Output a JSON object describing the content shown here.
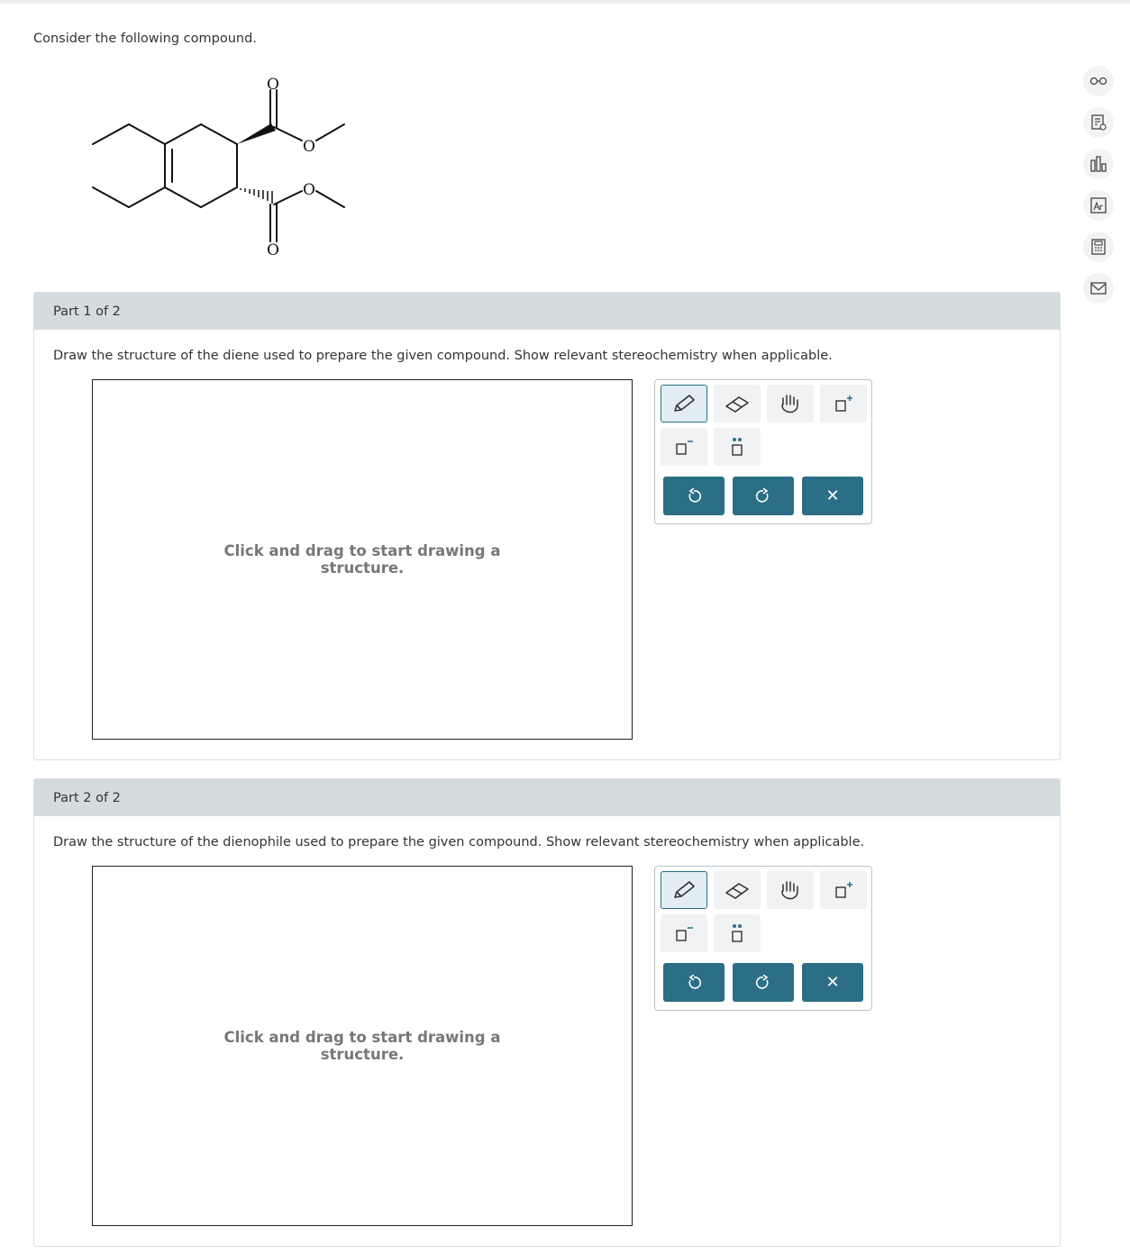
{
  "intro": "Consider the following compound.",
  "molecule": {
    "atom_labels": [
      "O",
      "O",
      "O",
      "O"
    ]
  },
  "parts": [
    {
      "header": "Part 1 of 2",
      "question": "Draw the structure of the diene used to prepare the given compound. Show relevant stereochemistry when applicable.",
      "canvas_hint_line1": "Click and drag to start drawing a",
      "canvas_hint_line2": "structure."
    },
    {
      "header": "Part 2 of 2",
      "question": "Draw the structure of the dienophile used to prepare the given compound. Show relevant stereochemistry when applicable.",
      "canvas_hint_line1": "Click and drag to start drawing a",
      "canvas_hint_line2": "structure."
    }
  ],
  "toolbar": {
    "tools": [
      "pencil-icon",
      "eraser-icon",
      "hand-icon",
      "positive-charge-icon",
      "negative-charge-icon",
      "lone-pair-icon"
    ],
    "actions": [
      "undo-icon",
      "redo-icon",
      "clear-icon"
    ],
    "clear_glyph": "✕"
  },
  "sidebar": {
    "icons": [
      "glasses-icon",
      "document-check-icon",
      "bar-chart-icon",
      "periodic-table-icon",
      "calculator-icon",
      "mail-icon"
    ]
  },
  "colors": {
    "accent": "#2c6e86",
    "header_bg": "#d5dce0"
  }
}
